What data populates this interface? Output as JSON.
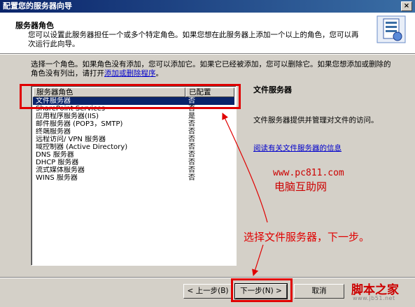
{
  "window": {
    "title": "配置您的服务器向导",
    "close_glyph": "×"
  },
  "header": {
    "title": "服务器角色",
    "description": "您可以设置此服务器担任一个或多个特定角色。如果您想在此服务器上添加一个以上的角色，您可以再次运行此向导。"
  },
  "intro": {
    "text": "选择一个角色。如果角色没有添加，您可以添加它。如果它已经被添加，您可以删除它。如果您想添加或删除的角色没有列出，请打开",
    "link": "添加或删除程序",
    "suffix": "。"
  },
  "list": {
    "headers": {
      "role": "服务器角色",
      "configured": "已配置"
    },
    "rows": [
      {
        "role": "文件服务器",
        "configured": "否"
      },
      {
        "role": "SharePoint Services",
        "configured": "否"
      },
      {
        "role": "应用程序服务器(IIS)",
        "configured": "是"
      },
      {
        "role": "邮件服务器 (POP3，SMTP)",
        "configured": "否"
      },
      {
        "role": "终端服务器",
        "configured": "否"
      },
      {
        "role": "远程访问/ VPN 服务器",
        "configured": "否"
      },
      {
        "role": "域控制器 (Active Directory)",
        "configured": "否"
      },
      {
        "role": "DNS 服务器",
        "configured": "否"
      },
      {
        "role": "DHCP 服务器",
        "configured": "否"
      },
      {
        "role": "流式媒体服务器",
        "configured": "否"
      },
      {
        "role": "WINS 服务器",
        "configured": "否"
      }
    ]
  },
  "detail": {
    "title": "文件服务器",
    "description": "文件服务器提供并管理对文件的访问。",
    "link": "阅读有关文件服务器的信息"
  },
  "watermark": {
    "url": "www.pc811.com",
    "name": "电脑互助网"
  },
  "annotation": {
    "text": "选择文件服务器，下一步。"
  },
  "footer": {
    "back_label": "< 上一步(B)",
    "next_label": "下一步(N) >",
    "cancel_label": "取消",
    "brand": "脚本之家",
    "brand_sub": "www.jb51.net"
  },
  "colors": {
    "selection": "#0a246a",
    "annotation_red": "#e00000",
    "dialog_bg": "#d4d0c8"
  }
}
